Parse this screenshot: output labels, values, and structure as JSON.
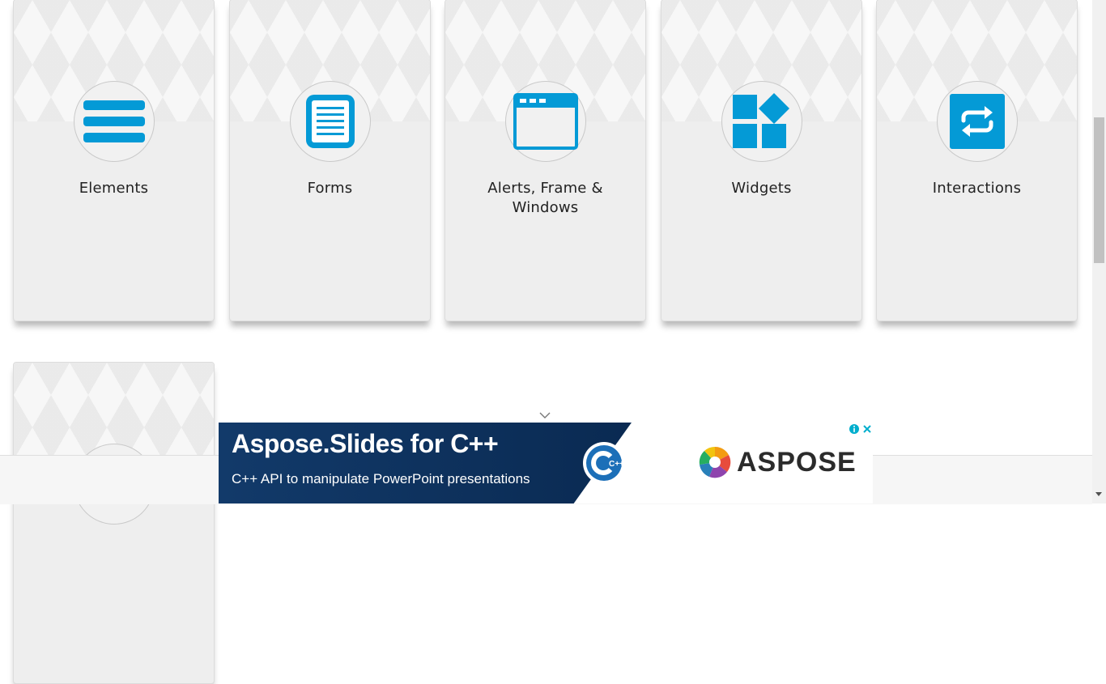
{
  "cards": [
    {
      "title": "Elements",
      "icon": "list-icon"
    },
    {
      "title": "Forms",
      "icon": "document-icon"
    },
    {
      "title": "Alerts, Frame & Windows",
      "icon": "window-icon"
    },
    {
      "title": "Widgets",
      "icon": "widgets-icon"
    },
    {
      "title": "Interactions",
      "icon": "interactions-icon"
    }
  ],
  "colors": {
    "accent": "#049ad6",
    "card_bg": "#eeeeee",
    "ad_bg": "#0f3460"
  },
  "ad": {
    "title": "Aspose.Slides for C++",
    "subtitle": "C++ API to manipulate PowerPoint presentations",
    "brand": "ASPOSE",
    "cpp_badge": "C++"
  }
}
